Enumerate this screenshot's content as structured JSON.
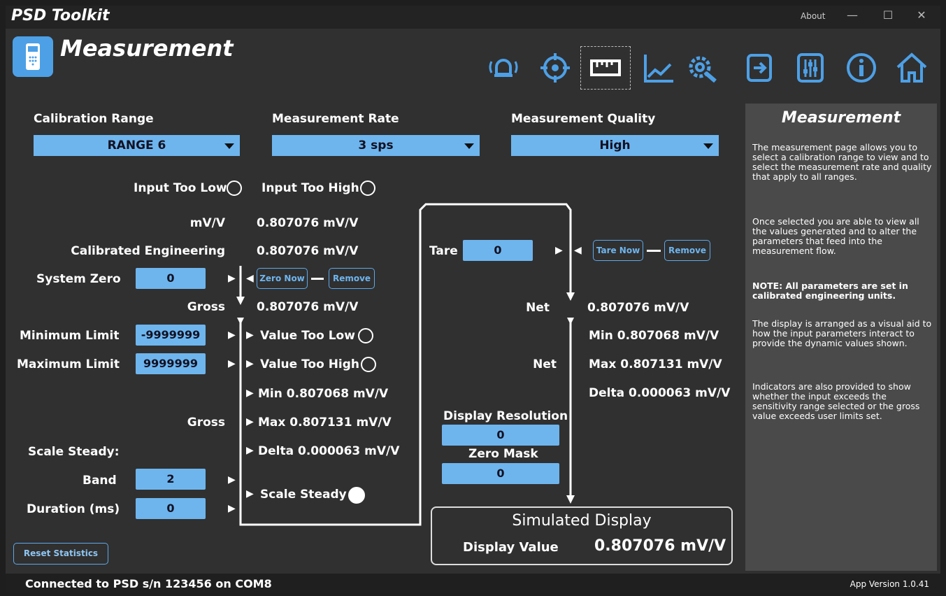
{
  "app": {
    "title": "PSD Toolkit",
    "about": "About"
  },
  "page": {
    "title": "Measurement"
  },
  "nav": [
    "alarm-icon",
    "target-icon",
    "ruler-icon",
    "chart-icon",
    "settings-icon",
    "export-icon",
    "sliders-icon",
    "info-icon",
    "home-icon"
  ],
  "accent": "#6eb5ee",
  "calibration_range": {
    "label": "Calibration Range",
    "value": "RANGE 6"
  },
  "measurement_rate": {
    "label": "Measurement Rate",
    "value": "3 sps"
  },
  "measurement_quality": {
    "label": "Measurement Quality",
    "value": "High"
  },
  "input_too_low": "Input Too Low",
  "input_too_high": "Input Too High",
  "mvv": {
    "label": "mV/V",
    "value": "0.807076 mV/V"
  },
  "calibrated": {
    "label": "Calibrated Engineering",
    "value": "0.807076 mV/V"
  },
  "system_zero": {
    "label": "System Zero",
    "value": "0",
    "zero_now": "Zero Now",
    "remove": "Remove"
  },
  "gross": {
    "label": "Gross",
    "value": "0.807076 mV/V"
  },
  "min_limit": {
    "label": "Minimum Limit",
    "value": "-9999999",
    "indicator": "Value Too Low"
  },
  "max_limit": {
    "label": "Maximum Limit",
    "value": "9999999",
    "indicator": "Value Too High"
  },
  "gross_stats": {
    "label": "Gross",
    "min_label": "Min",
    "min": "0.807068 mV/V",
    "max_label": "Max",
    "max": "0.807131 mV/V",
    "delta_label": "Delta",
    "delta": "0.000063 mV/V"
  },
  "scale_steady": {
    "label": "Scale Steady:",
    "band_label": "Band",
    "band": "2",
    "duration_label": "Duration (ms)",
    "duration": "0",
    "indicator": "Scale Steady"
  },
  "tare": {
    "label": "Tare",
    "value": "0",
    "tare_now": "Tare Now",
    "remove": "Remove"
  },
  "net": {
    "label": "Net",
    "value": "0.807076 mV/V"
  },
  "net_stats": {
    "label": "Net",
    "min_label": "Min",
    "min": "0.807068 mV/V",
    "max_label": "Max",
    "max": "0.807131 mV/V",
    "delta_label": "Delta",
    "delta": "0.000063 mV/V"
  },
  "display_resolution": {
    "label": "Display Resolution",
    "value": "0"
  },
  "zero_mask": {
    "label": "Zero Mask",
    "value": "0"
  },
  "simulated_display": {
    "title": "Simulated Display",
    "label": "Display Value",
    "value": "0.807076 mV/V"
  },
  "reset_statistics": "Reset Statistics",
  "help": {
    "title": "Measurement",
    "p1": "The measurement page allows you to select a calibration range to view and to select the measurement rate and quality that apply to all ranges.",
    "p2": "Once selected you are able to view all the values generated and to alter the parameters that feed into the measurement flow.",
    "p3": "NOTE: All parameters are set in calibrated engineering units.",
    "p4": "The display is arranged as a visual aid to how the input parameters interact to provide the dynamic values shown.",
    "p5": "Indicators are also provided to show whether the input exceeds the sensitivity range selected or the gross value exceeds user limits set."
  },
  "status": {
    "connection": "Connected to PSD s/n 123456 on COM8",
    "version": "App Version 1.0.41"
  }
}
